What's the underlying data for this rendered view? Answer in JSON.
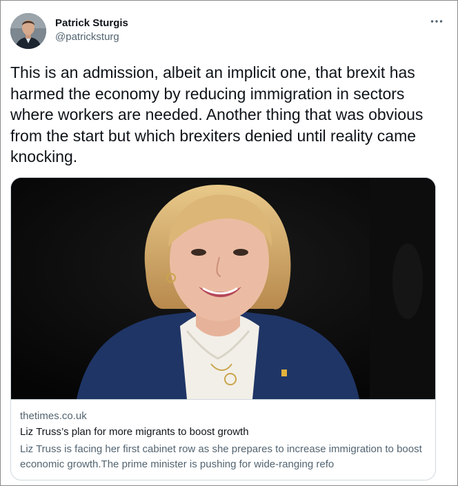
{
  "tweet": {
    "author": {
      "display_name": "Patrick Sturgis",
      "handle": "@patricksturg"
    },
    "more_icon": "more-horizontal-icon",
    "text": "This is an admission, albeit an implicit one, that brexit has harmed the economy by reducing immigration in sectors where workers are needed. Another thing that was obvious from the start but which brexiters denied until reality came knocking."
  },
  "card": {
    "domain": "thetimes.co.uk",
    "title": "Liz Truss’s plan for more migrants to boost growth",
    "description": "Liz Truss is facing her first cabinet row as she prepares to increase immigration to boost economic growth.The prime minister is pushing for wide-ranging refo"
  },
  "colors": {
    "text_primary": "#0f1419",
    "text_secondary": "#536471",
    "border": "#cfd9de",
    "jacket_navy": "#1f3566"
  }
}
